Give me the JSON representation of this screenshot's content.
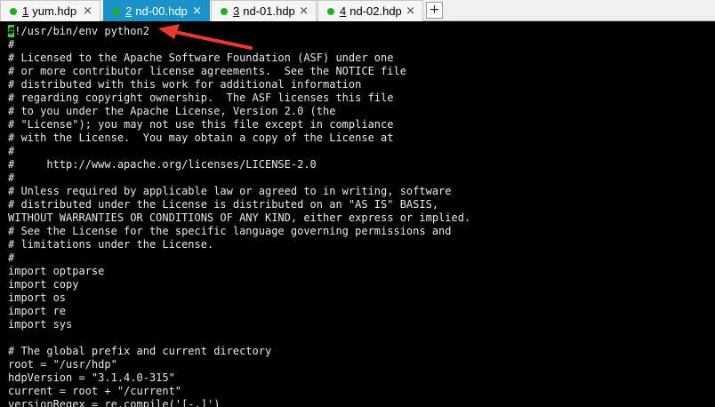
{
  "tabs": [
    {
      "num": "1",
      "label": "yum.hdp",
      "close": "×"
    },
    {
      "num": "2",
      "label": "nd-00.hdp",
      "close": "×"
    },
    {
      "num": "3",
      "label": "nd-01.hdp",
      "close": "×"
    },
    {
      "num": "4",
      "label": "nd-02.hdp",
      "close": "×"
    }
  ],
  "new_tab": "+",
  "colors": {
    "active_tab": "#1b93c9",
    "status_dot": "#1eb11e",
    "cursor": "#3fd23f",
    "arrow": "#e63a2e"
  },
  "terminal": {
    "cursor_char": "#",
    "first_line_rest": "!/usr/bin/env python2",
    "lines": [
      "#",
      "# Licensed to the Apache Software Foundation (ASF) under one",
      "# or more contributor license agreements.  See the NOTICE file",
      "# distributed with this work for additional information",
      "# regarding copyright ownership.  The ASF licenses this file",
      "# to you under the Apache License, Version 2.0 (the",
      "# \"License\"); you may not use this file except in compliance",
      "# with the License.  You may obtain a copy of the License at",
      "#",
      "#     http://www.apache.org/licenses/LICENSE-2.0",
      "#",
      "# Unless required by applicable law or agreed to in writing, software",
      "# distributed under the License is distributed on an \"AS IS\" BASIS,",
      "WITHOUT WARRANTIES OR CONDITIONS OF ANY KIND, either express or implied.",
      "# See the License for the specific language governing permissions and",
      "# limitations under the License.",
      "#",
      "import optparse",
      "import copy",
      "import os",
      "import re",
      "import sys",
      "",
      "# The global prefix and current directory",
      "root = \"/usr/hdp\"",
      "hdpVersion = \"3.1.4.0-315\"",
      "current = root + \"/current\"",
      "versionRegex = re.compile('[-.]')"
    ]
  }
}
